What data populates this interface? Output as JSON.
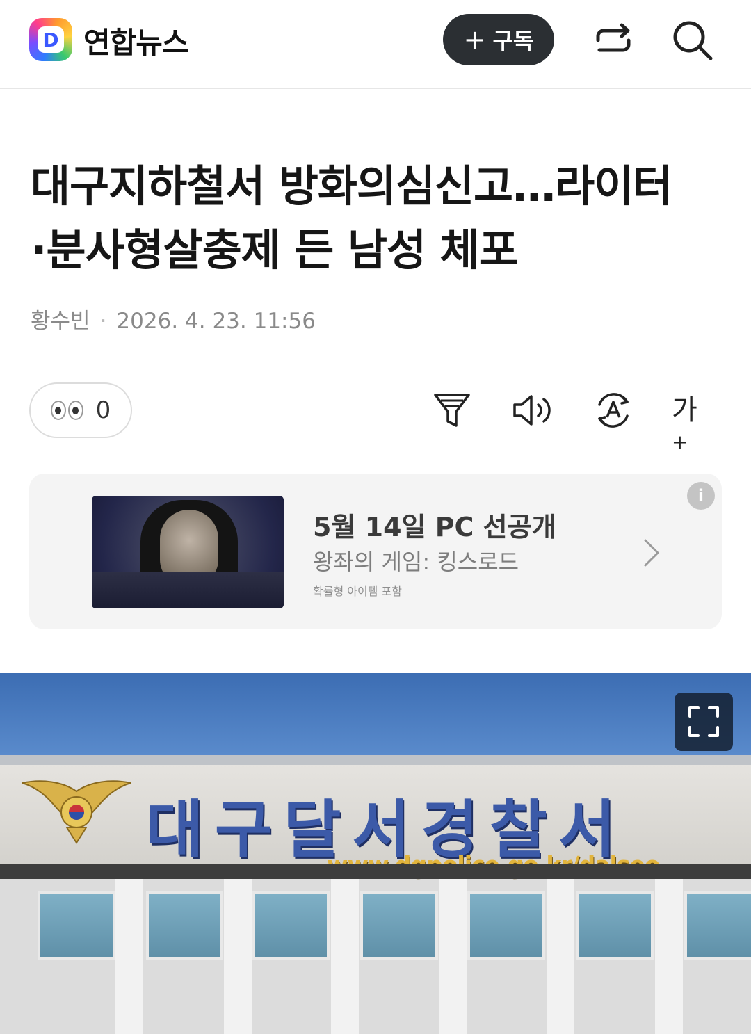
{
  "header": {
    "logo_letter": "D",
    "brand": "연합뉴스",
    "subscribe_plus": "+",
    "subscribe_label": "구독",
    "icons": [
      "share-icon",
      "search-icon"
    ]
  },
  "article": {
    "title_line1": "대구지하철서 방화의심신고…라이터",
    "title_line2": "·분사형살충제 든 남성 체포",
    "author": "황수빈",
    "separator": "·",
    "datetime": "2026. 4. 23. 11:56"
  },
  "toolbar": {
    "views_count": "0",
    "tools": [
      "summary-filter-icon",
      "speaker-icon",
      "translate-icon",
      "font-size-icon"
    ],
    "font_size_label": "가",
    "font_size_plus": "+"
  },
  "ad": {
    "headline": "5월 14일 PC 선공개",
    "subtitle": "왕좌의 게임: 킹스로드",
    "note": "확률형 아이템 포함",
    "info_glyph": "i"
  },
  "photo": {
    "sign_text": "대구달서경찰서",
    "sign_url": "www.dgpolice.go.kr/dalseo"
  },
  "colors": {
    "subscribe_bg": "#2b2f33",
    "brand_blue": "#3a58ff",
    "sky": "#4a7cc0",
    "sign_blue": "#3c5aa8",
    "sign_gold": "#e2b43c"
  }
}
